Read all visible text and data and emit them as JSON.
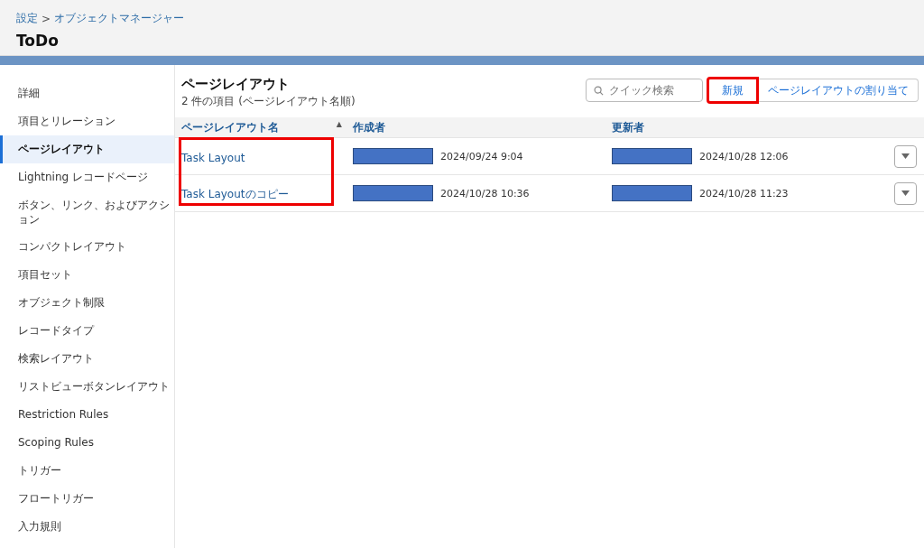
{
  "header": {
    "breadcrumb": [
      {
        "label": "設定"
      },
      {
        "label": "オブジェクトマネージャー"
      }
    ],
    "separator": ">",
    "title": "ToDo"
  },
  "sidebar": {
    "items": [
      {
        "label": "詳細",
        "selected": false
      },
      {
        "label": "項目とリレーション",
        "selected": false
      },
      {
        "label": "ページレイアウト",
        "selected": true
      },
      {
        "label": "Lightning レコードページ",
        "selected": false
      },
      {
        "label": "ボタン、リンク、およびアクション",
        "selected": false
      },
      {
        "label": "コンパクトレイアウト",
        "selected": false
      },
      {
        "label": "項目セット",
        "selected": false
      },
      {
        "label": "オブジェクト制限",
        "selected": false
      },
      {
        "label": "レコードタイプ",
        "selected": false
      },
      {
        "label": "検索レイアウト",
        "selected": false
      },
      {
        "label": "リストビューボタンレイアウト",
        "selected": false
      },
      {
        "label": "Restriction Rules",
        "selected": false
      },
      {
        "label": "Scoping Rules",
        "selected": false
      },
      {
        "label": "トリガー",
        "selected": false
      },
      {
        "label": "フロートリガー",
        "selected": false
      },
      {
        "label": "入力規則",
        "selected": false
      }
    ]
  },
  "main": {
    "title": "ページレイアウト",
    "subtitle": "2 件の項目 (ページレイアウト名順)",
    "search": {
      "placeholder": "クイック検索"
    },
    "buttons": [
      {
        "label": "新規",
        "highlighted": true
      },
      {
        "label": "ページレイアウトの割り当て",
        "highlighted": false
      }
    ]
  },
  "table": {
    "columns": [
      {
        "label": "ページレイアウト名",
        "sort": "▲"
      },
      {
        "label": "作成者"
      },
      {
        "label": "更新者"
      }
    ],
    "names_highlighted": true,
    "rows": [
      {
        "name": "Task Layout",
        "created": "2024/09/24 9:04",
        "modified": "2024/10/28 12:06"
      },
      {
        "name": "Task Layoutのコピー",
        "created": "2024/10/28 10:36",
        "modified": "2024/10/28 11:23"
      }
    ]
  }
}
